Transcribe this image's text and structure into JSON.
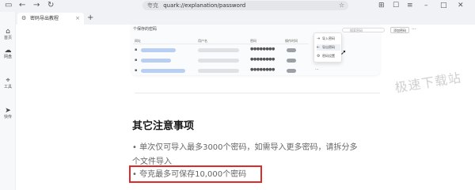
{
  "browser": {
    "address_site": "夸克",
    "address_url": "quark://explanation/password",
    "tab_title": "密码导出教程"
  },
  "sidebar": {
    "items": [
      {
        "label": "首页",
        "icon": "home-icon"
      },
      {
        "label": "网盘",
        "icon": "cloud-icon"
      },
      {
        "label": "工具",
        "icon": "scan-icon"
      },
      {
        "label": "快传",
        "icon": "send-icon"
      }
    ]
  },
  "screenshot": {
    "title": "个保存的密码",
    "search_placeholder": "搜索密码",
    "add_button": "添加密码",
    "more": "···",
    "headers": [
      "网址",
      "用户名",
      "密码",
      "操作时间"
    ],
    "menu": [
      "导入密码",
      "导出密码",
      "密码设置"
    ]
  },
  "watermark": "极速下载站",
  "article": {
    "heading": "其它注意事项",
    "bullet1": "• 单次仅可导入最多3000个密码，如需导入更多密码，请拆分多个文件导入",
    "bullet2": "• 夸克最多可保存10,000个密码"
  }
}
